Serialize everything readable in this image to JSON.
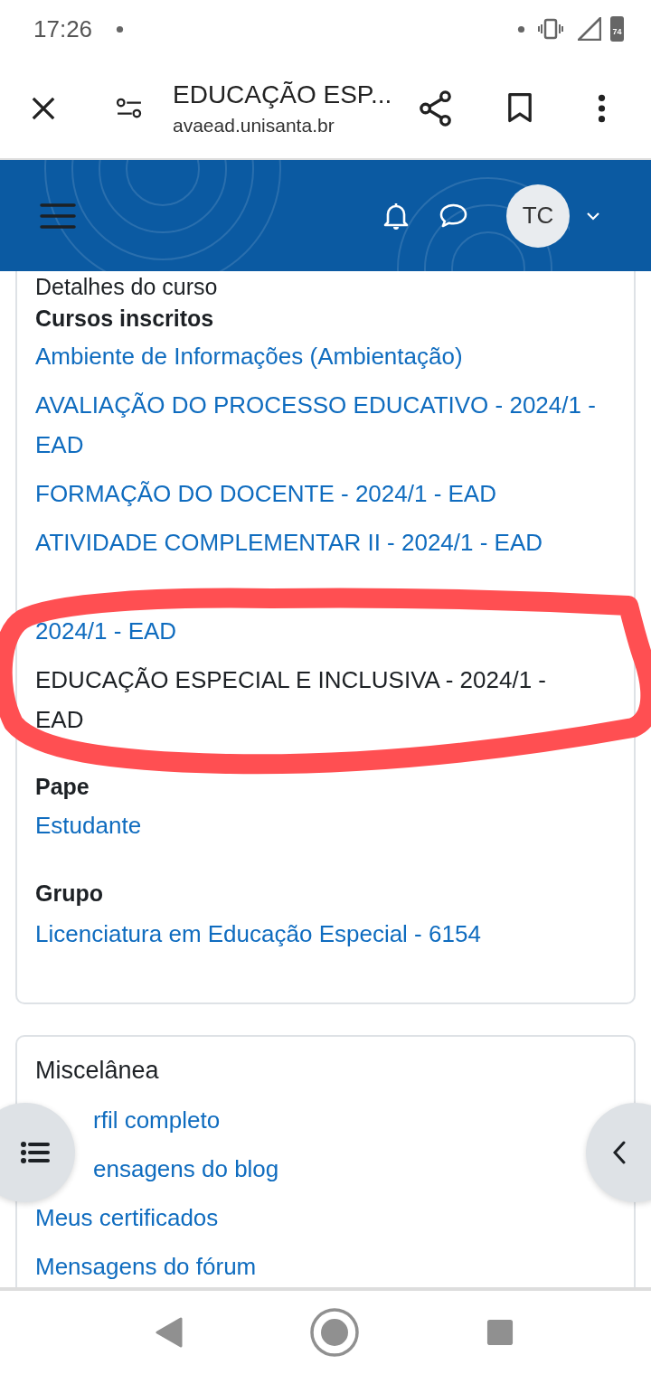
{
  "status_bar": {
    "time": "17:26",
    "battery": "74"
  },
  "browser_bar": {
    "title": "EDUCAÇÃO ESP...",
    "url": "avaead.unisanta.br"
  },
  "site_header": {
    "avatar_initials": "TC"
  },
  "course_card": {
    "cut_heading": "Detalhes do curso",
    "heading": "Cursos inscritos",
    "courses": [
      {
        "kind": "link",
        "text": "Ambiente de Informações (Ambientação)"
      },
      {
        "kind": "link",
        "text": "AVALIAÇÃO DO PROCESSO EDUCATIVO - 2024/1 - EAD"
      },
      {
        "kind": "link",
        "text": "FORMAÇÃO DO DOCENTE - 2024/1 - EAD"
      },
      {
        "kind": "link",
        "text": "ATIVIDADE COMPLEMENTAR II - 2024/1 - EAD"
      },
      {
        "kind": "covered",
        "text": "2024/1 - EAD"
      },
      {
        "kind": "current",
        "text": "EDUCAÇÃO ESPECIAL E INCLUSIVA - 2024/1 - EAD"
      }
    ],
    "roles_heading": "Pape",
    "role": "Estudante",
    "group_heading": "Grupo",
    "group": "Licenciatura em Educação Especial - 6154"
  },
  "misc_card": {
    "heading": "Miscelânea",
    "links": [
      "rfil completo",
      "ensagens do blog",
      "Meus certificados",
      "Mensagens do fórum"
    ]
  }
}
